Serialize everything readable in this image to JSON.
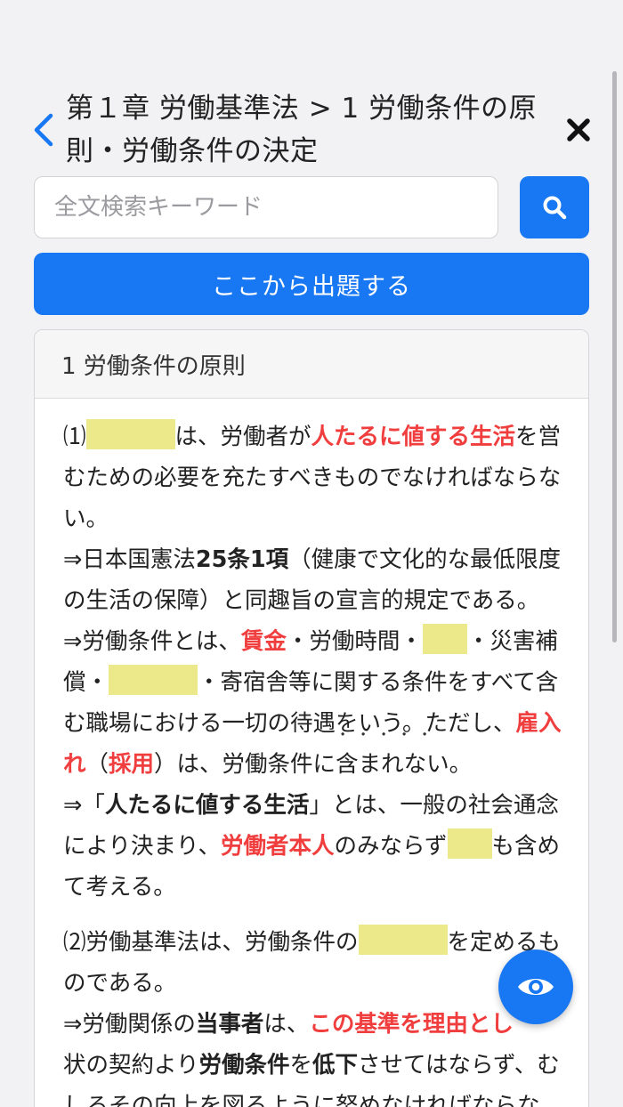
{
  "header": {
    "title_line1": "第１章 労働基準法 > 1 労働条件の原",
    "title_line2": "則・労働条件の決定",
    "back_icon": "chevron-left-icon",
    "close_icon": "close-icon"
  },
  "search": {
    "placeholder": "全文検索キーワード",
    "value": "",
    "button_icon": "search-icon"
  },
  "primary_button": {
    "label": "ここから出題する"
  },
  "card": {
    "header": "1 労働条件の原則",
    "p1": {
      "l1_a": "⑴",
      "l1_b": "は、労働者が",
      "l1_c": "人たるに値する生活",
      "l1_d": "を営",
      "l2": "むための必要を充たすべきものでなければならな",
      "l3": "い。",
      "l4_a": "⇒日本国憲法",
      "l4_b": "25条1項",
      "l4_c": "（健康で文化的な最低限度",
      "l5": "の生活の保障）と同趣旨の宣言的規定である。",
      "l6_a": "⇒労働条件とは、",
      "l6_b": "賃金",
      "l6_c": "・労働時間・",
      "l6_d": "・災害補",
      "l7_a": "償・",
      "l7_b": "・寄宿舎等に関する条件をすべて含",
      "l8_a": "む職場における一切の待遇をいう。ただし、",
      "l8_b": "雇入",
      "l9_a": "れ",
      "l9_b": "（",
      "l9_c": "採用",
      "l9_d": "）は、労働条件に",
      "l9_e": "含まれない",
      "l9_f": "。",
      "l10_a": "⇒「",
      "l10_b": "人たるに値する生活",
      "l10_c": "」とは、一般の社会通念",
      "l11_a": "により決まり、",
      "l11_b": "労働者本人",
      "l11_c": "のみならず",
      "l11_d": "も含め",
      "l12": "て考える。"
    },
    "p2": {
      "l1_a": "⑵労働基準法は、労働条件の",
      "l1_b": "を定めるも",
      "l2": "のである。",
      "l3_a": "⇒労働関係の",
      "l3_b": "当事者",
      "l3_c": "は、",
      "l3_d": "この基準を理由とし",
      "l4_a": "状の契約より",
      "l4_b": "労働条件",
      "l4_c": "を",
      "l4_d": "低下",
      "l4_e": "させてはならず、む",
      "l5": "しろその向上を図るように努めなければならな"
    }
  },
  "fab": {
    "icon": "eye-icon"
  },
  "colors": {
    "accent": "#1877f2",
    "highlight_red": "#f03d3d",
    "blank_fill": "#ece98a"
  }
}
